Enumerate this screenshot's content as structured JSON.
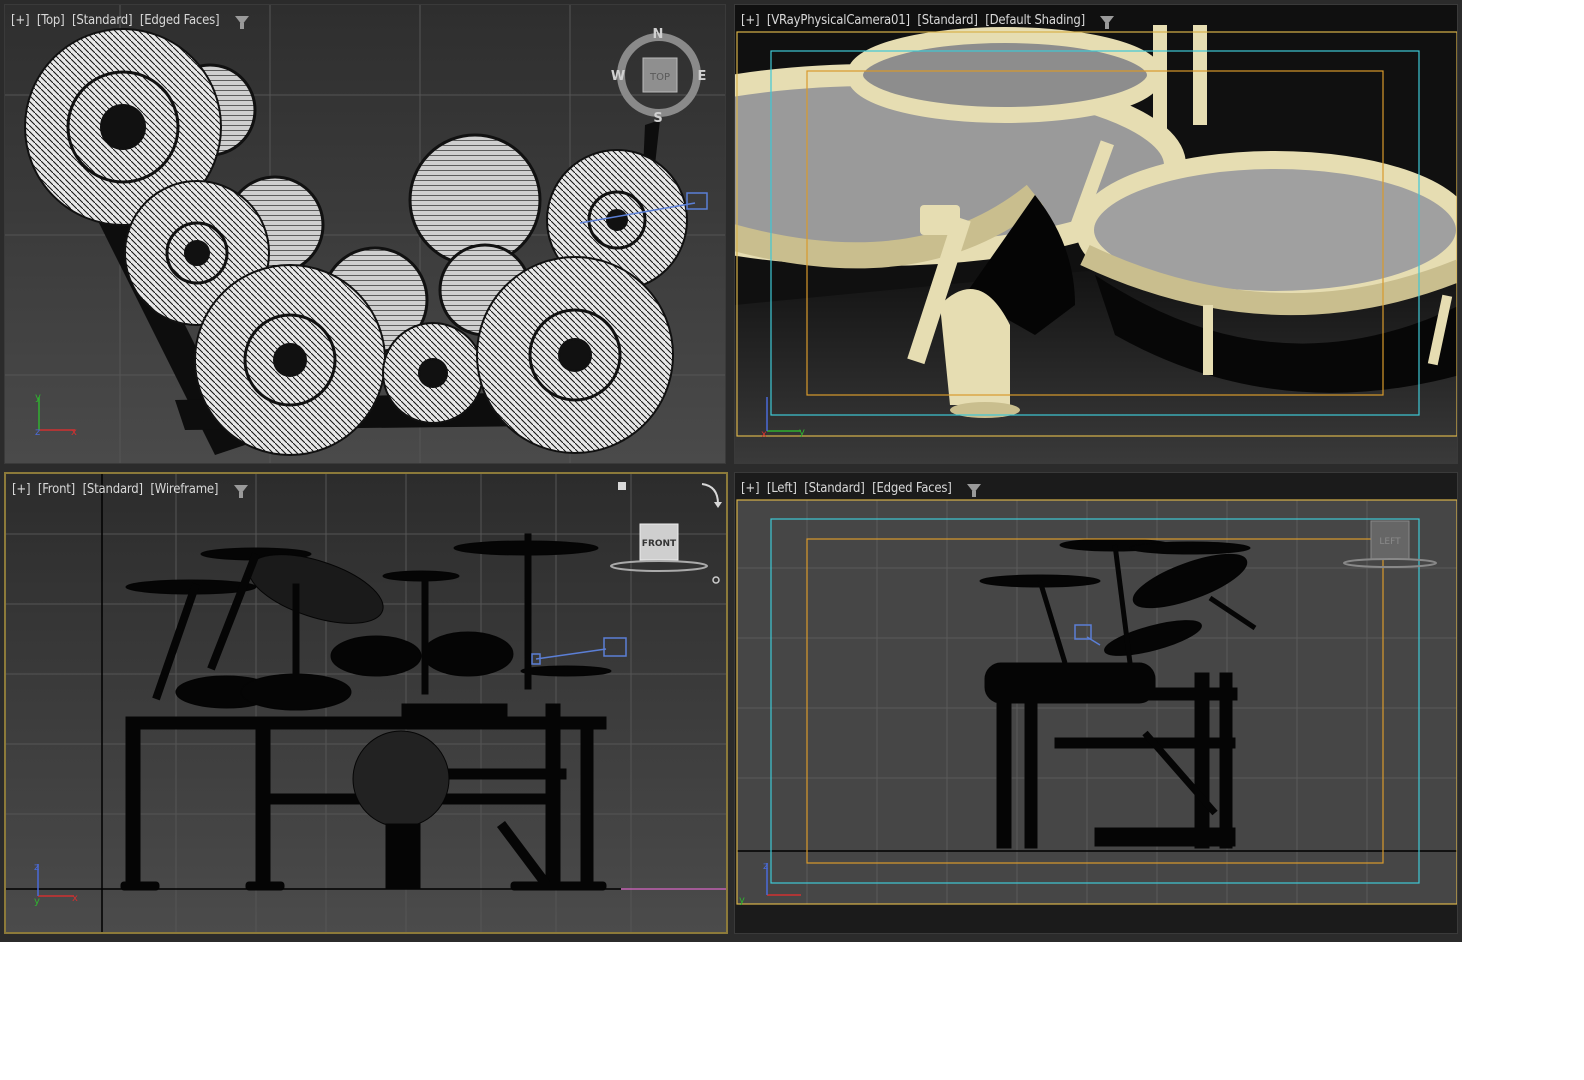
{
  "viewports": {
    "top": {
      "menu": "[+]",
      "view": "[Top]",
      "shading": "[Standard]",
      "mode": "[Edged Faces]",
      "compass": {
        "n": "N",
        "s": "S",
        "e": "E",
        "w": "W"
      },
      "cube_label": "TOP"
    },
    "camera": {
      "menu": "[+]",
      "view": "[VRayPhysicalCamera01]",
      "shading": "[Standard]",
      "mode": "[Default Shading]"
    },
    "front": {
      "menu": "[+]",
      "view": "[Front]",
      "shading": "[Standard]",
      "mode": "[Wireframe]",
      "cube_label": "FRONT"
    },
    "left": {
      "menu": "[+]",
      "view": "[Left]",
      "shading": "[Standard]",
      "mode": "[Edged Faces]",
      "cube_label": "LEFT"
    }
  },
  "colors": {
    "safe_frame_outer": "#d8b24a",
    "safe_frame_action": "#3ec9d6",
    "safe_frame_title": "#d89a2c",
    "active_border": "#8c7a3a",
    "drum_shell": "#e6ddb2"
  },
  "icons": [
    "filter-icon",
    "viewcube-icon",
    "compass-icon",
    "camera-icon",
    "axis-tripod-icon",
    "orbit-arrow-icon",
    "home-icon"
  ]
}
